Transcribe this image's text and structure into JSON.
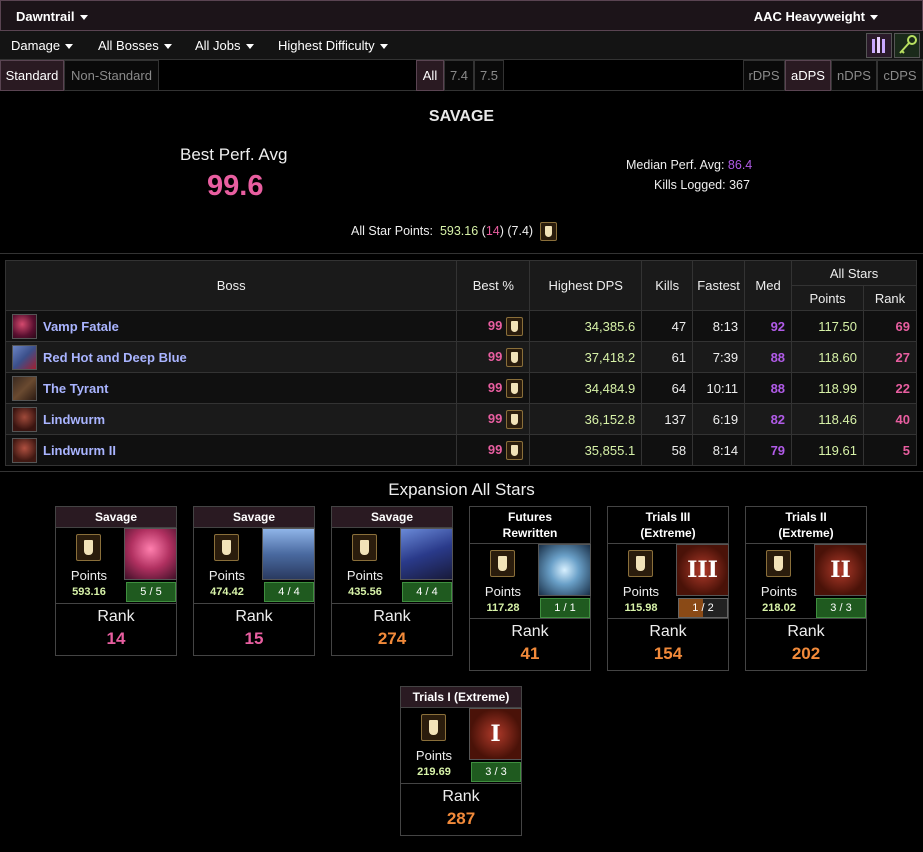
{
  "topbar": {
    "expansion": "Dawntrail",
    "division": "AAC Heavyweight"
  },
  "filters": {
    "metric": "Damage",
    "bosses": "All Bosses",
    "jobs": "All Jobs",
    "difficulty": "Highest Difficulty"
  },
  "tabs": {
    "standard": "Standard",
    "non_standard": "Non-Standard",
    "all": "All",
    "v74": "7.4",
    "v75": "7.5",
    "rdps": "rDPS",
    "adps": "aDPS",
    "ndps": "nDPS",
    "cdps": "cDPS"
  },
  "summary": {
    "section": "SAVAGE",
    "best_perf_label": "Best Perf. Avg",
    "best_perf_value": "99.6",
    "median_label": "Median Perf. Avg:",
    "median_value": "86.4",
    "kills_label": "Kills Logged:",
    "kills_value": "367",
    "star_label": "All Star Points:",
    "star_points": "593.16",
    "star_open": " (",
    "star_rank": "14",
    "star_close": ") (7.4)"
  },
  "table": {
    "headers": {
      "boss": "Boss",
      "best": "Best %",
      "dps": "Highest DPS",
      "kills": "Kills",
      "fastest": "Fastest",
      "med": "Med",
      "allstars": "All Stars",
      "points": "Points",
      "rank": "Rank"
    },
    "rows": [
      {
        "name": "Vamp Fatale",
        "best": "99",
        "dps": "34,385.6",
        "kills": "47",
        "fastest": "8:13",
        "med": "92",
        "points": "117.50",
        "rank": "69"
      },
      {
        "name": "Red Hot and Deep Blue",
        "best": "99",
        "dps": "37,418.2",
        "kills": "61",
        "fastest": "7:39",
        "med": "88",
        "points": "118.60",
        "rank": "27"
      },
      {
        "name": "The Tyrant",
        "best": "99",
        "dps": "34,484.9",
        "kills": "64",
        "fastest": "10:11",
        "med": "88",
        "points": "118.99",
        "rank": "22"
      },
      {
        "name": "Lindwurm",
        "best": "99",
        "dps": "36,152.8",
        "kills": "137",
        "fastest": "6:19",
        "med": "82",
        "points": "118.46",
        "rank": "40"
      },
      {
        "name": "Lindwurm II",
        "best": "99",
        "dps": "35,855.1",
        "kills": "58",
        "fastest": "8:14",
        "med": "79",
        "points": "119.61",
        "rank": "5"
      }
    ]
  },
  "expansion": {
    "title": "Expansion All Stars",
    "points_label": "Points",
    "rank_label": "Rank",
    "cards": [
      {
        "title": "Savage",
        "points": "593.16",
        "count": "5 / 5",
        "rank": "14"
      },
      {
        "title": "Savage",
        "points": "474.42",
        "count": "4 / 4",
        "rank": "15"
      },
      {
        "title": "Savage",
        "points": "435.56",
        "count": "4 / 4",
        "rank": "274"
      },
      {
        "title": "Futures Rewritten",
        "points": "117.28",
        "count": "1 / 1",
        "rank": "41"
      },
      {
        "title": "Trials III (Extreme)",
        "points": "115.98",
        "count": "1 / 2",
        "rank": "154",
        "numeral": "III"
      },
      {
        "title": "Trials II (Extreme)",
        "points": "218.02",
        "count": "3 / 3",
        "rank": "202",
        "numeral": "II"
      },
      {
        "title": "Trials I (Extreme)",
        "points": "219.69",
        "count": "3 / 3",
        "rank": "287",
        "numeral": "I"
      }
    ]
  },
  "colors": {
    "pink": "#e85ea0",
    "purple": "#b15be8",
    "green": "#d7f2a8",
    "orange": "#f28a3a",
    "boss_name": "#a9b4ff"
  }
}
